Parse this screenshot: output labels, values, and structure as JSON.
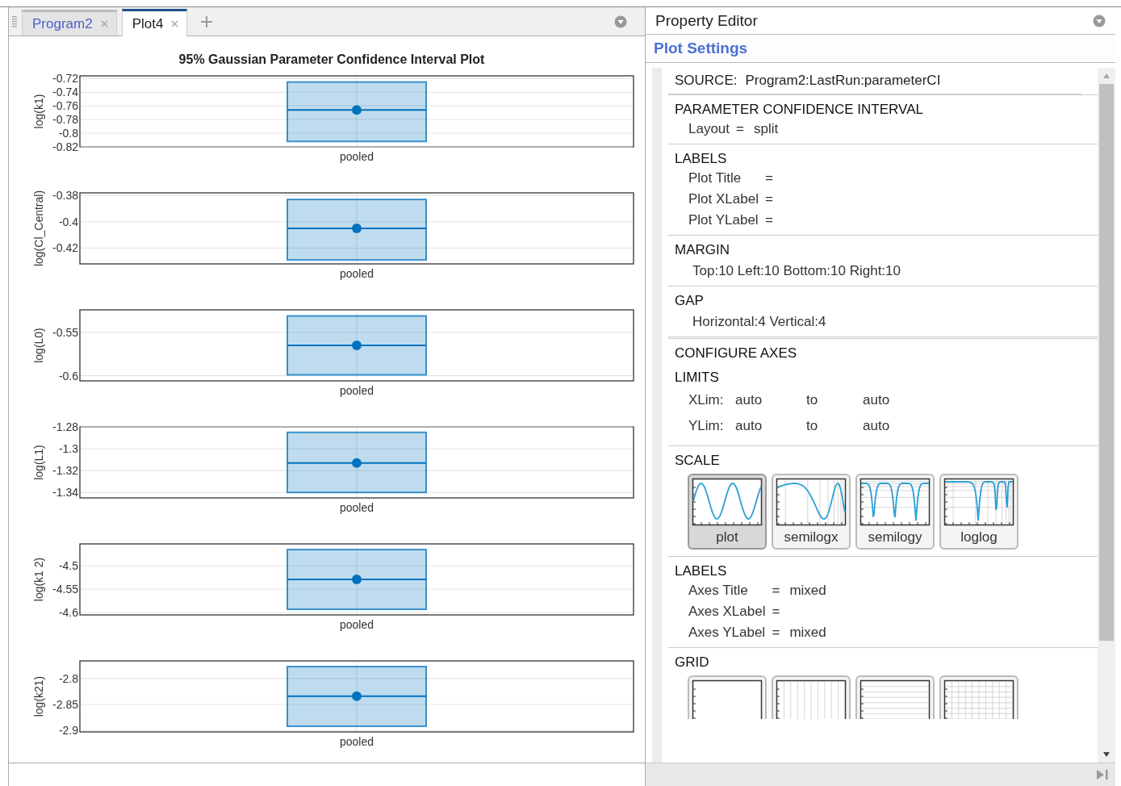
{
  "tabs": [
    {
      "label": "Program2",
      "selected": false
    },
    {
      "label": "Plot4",
      "selected": true
    }
  ],
  "plot": {
    "title": "95% Gaussian Parameter Confidence Interval Plot",
    "subplots": [
      {
        "chart_data": {
          "type": "scatter",
          "ylabel": "log(k1)",
          "categories": [
            "pooled"
          ],
          "values": [
            -0.766
          ],
          "ylim": [
            -0.82,
            -0.716
          ],
          "yticks": [
            -0.72,
            -0.74,
            -0.76,
            -0.78,
            -0.8,
            -0.82
          ],
          "grid": true,
          "bands": [
            {
              "axis": "y",
              "from": -0.812,
              "to": -0.725
            }
          ]
        }
      },
      {
        "chart_data": {
          "type": "scatter",
          "ylabel": "log(Cl_Central)",
          "categories": [
            "pooled"
          ],
          "values": [
            -0.405
          ],
          "ylim": [
            -0.432,
            -0.378
          ],
          "yticks": [
            -0.38,
            -0.4,
            -0.42
          ],
          "grid": true,
          "bands": [
            {
              "axis": "y",
              "from": -0.429,
              "to": -0.383
            }
          ]
        }
      },
      {
        "chart_data": {
          "type": "scatter",
          "ylabel": "log(L0)",
          "categories": [
            "pooled"
          ],
          "values": [
            -0.565
          ],
          "ylim": [
            -0.606,
            -0.524
          ],
          "yticks": [
            -0.55,
            -0.6
          ],
          "grid": true,
          "bands": [
            {
              "axis": "y",
              "from": -0.599,
              "to": -0.531
            }
          ]
        }
      },
      {
        "chart_data": {
          "type": "scatter",
          "ylabel": "log(L1)",
          "categories": [
            "pooled"
          ],
          "values": [
            -1.313
          ],
          "ylim": [
            -1.345,
            -1.28
          ],
          "yticks": [
            -1.28,
            -1.3,
            -1.32,
            -1.34
          ],
          "grid": true,
          "bands": [
            {
              "axis": "y",
              "from": -1.34,
              "to": -1.285
            }
          ]
        }
      },
      {
        "chart_data": {
          "type": "scatter",
          "ylabel": "log(k1 2)",
          "categories": [
            "pooled"
          ],
          "values": [
            -4.529
          ],
          "ylim": [
            -4.605,
            -4.453
          ],
          "yticks": [
            -4.5,
            -4.55,
            -4.6
          ],
          "grid": true,
          "bands": [
            {
              "axis": "y",
              "from": -4.593,
              "to": -4.465
            }
          ]
        }
      },
      {
        "chart_data": {
          "type": "scatter",
          "ylabel": "log(k21)",
          "categories": [
            "pooled"
          ],
          "values": [
            -2.834
          ],
          "ylim": [
            -2.903,
            -2.766
          ],
          "yticks": [
            -2.8,
            -2.85,
            -2.9
          ],
          "grid": true,
          "bands": [
            {
              "axis": "y",
              "from": -2.892,
              "to": -2.777
            }
          ]
        }
      }
    ]
  },
  "property_editor": {
    "title": "Property Editor",
    "subtitle": "Plot Settings",
    "source": {
      "label": "SOURCE:",
      "value": "Program2:LastRun:parameterCI"
    },
    "sections": [
      {
        "kind": "fields",
        "heading": "PARAMETER CONFIDENCE INTERVAL",
        "fields": [
          {
            "label": "Layout",
            "sign": "=",
            "value": "split"
          }
        ]
      },
      {
        "kind": "fields",
        "heading": "LABELS",
        "fields": [
          {
            "label": "Plot Title",
            "sign": "="
          },
          {
            "label": "Plot XLabel",
            "sign": "="
          },
          {
            "label": "Plot YLabel",
            "sign": "="
          }
        ]
      },
      {
        "kind": "text",
        "heading": "MARGIN",
        "text": "Top:10 Left:10 Bottom:10 Right:10"
      },
      {
        "kind": "text",
        "heading": "GAP",
        "text": "Horizontal:4 Vertical:4"
      },
      {
        "kind": "limits",
        "heading": "CONFIGURE AXES",
        "subheading": "LIMITS",
        "rows": [
          {
            "label": "XLim:",
            "from": "auto",
            "sep": "to",
            "to": "auto"
          },
          {
            "label": "YLim:",
            "from": "auto",
            "sep": "to",
            "to": "auto"
          }
        ]
      },
      {
        "kind": "thumbs",
        "heading": "SCALE",
        "options": [
          {
            "kind": "linear",
            "label": "plot",
            "selected": true
          },
          {
            "kind": "logx",
            "label": "semilogx",
            "selected": false
          },
          {
            "kind": "logy",
            "label": "semilogy",
            "selected": false
          },
          {
            "kind": "loglog",
            "label": "loglog",
            "selected": false
          }
        ]
      },
      {
        "kind": "fields",
        "heading": "LABELS",
        "fields": [
          {
            "label": "Axes Title",
            "sign": "=",
            "value": "mixed"
          },
          {
            "label": "Axes XLabel",
            "sign": "="
          },
          {
            "label": "Axes YLabel",
            "sign": "=",
            "value": "mixed"
          }
        ]
      },
      {
        "kind": "grid",
        "heading": "GRID",
        "options": [
          {
            "kind": "none",
            "selected": false
          },
          {
            "kind": "x",
            "selected": false
          },
          {
            "kind": "y",
            "selected": false
          },
          {
            "kind": "xy",
            "selected": false
          }
        ]
      }
    ]
  }
}
